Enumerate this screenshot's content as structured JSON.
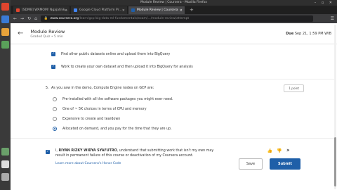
{
  "window": {
    "title": "Module Review | Coursera - Mozilla Firefox",
    "controls": "– ▫ ✕"
  },
  "tabs": [
    {
      "label": "[SDMB] WAMOM! Ngajatnik...",
      "color": "#e0452e"
    },
    {
      "label": "Google Cloud Platform Pr...",
      "color": "#4285f4"
    },
    {
      "label": "Module Review | Coursera",
      "color": "#1f5fa8"
    }
  ],
  "newtab_label": "+",
  "navbar": {
    "back": "←",
    "forward": "→",
    "reload": "↻",
    "home": "⌂",
    "url_host": "www.coursera.org",
    "url_rest": "/learn/gcp-big-data-ml-fundamentals/exam/.../module-review/attempt",
    "menu": "☰"
  },
  "page": {
    "back_icon": "←",
    "title": "Module Review",
    "subtitle": "Graded Quiz • 5 min",
    "due_label": "Due",
    "due_value": "Sep 21, 1:59 PM WIB"
  },
  "checks": [
    {
      "label": "Find other public datasets online and upload them into BigQuery"
    },
    {
      "label": "Work to create your own dataset and then upload it into BigQuery for analysis"
    }
  ],
  "question": {
    "number": "5.",
    "text": "As you saw in the demo, Compute Engine nodes on GCP are:",
    "points": "1 point",
    "options": [
      {
        "label": "Pre-installed with all the software packages you might ever need.",
        "selected": false
      },
      {
        "label": "One of ~ 5K choices in terms of CPU and memory",
        "selected": false
      },
      {
        "label": "Expensive to create and teardown",
        "selected": false
      },
      {
        "label": "Allocated on demand, and you pay for the time that they are up.",
        "selected": true
      }
    ]
  },
  "honor": {
    "name": "RIYAN RIZKY WIDYA SYAFUTRO",
    "text_prefix": "I, ",
    "text_suffix": ", understand that submitting work that isn't my own may result in permanent failure of this course or deactivation of my Coursera account.",
    "link": "Learn more about Coursera's Honor Code",
    "like": "👍",
    "dislike": "👎",
    "flag": "⚑"
  },
  "buttons": {
    "save": "Save",
    "submit": "Submit"
  },
  "dock_colors": [
    "#cc3333",
    "#3a7bd5",
    "#f0a030",
    "#5aa05a",
    "#cccccc",
    "#888888"
  ]
}
